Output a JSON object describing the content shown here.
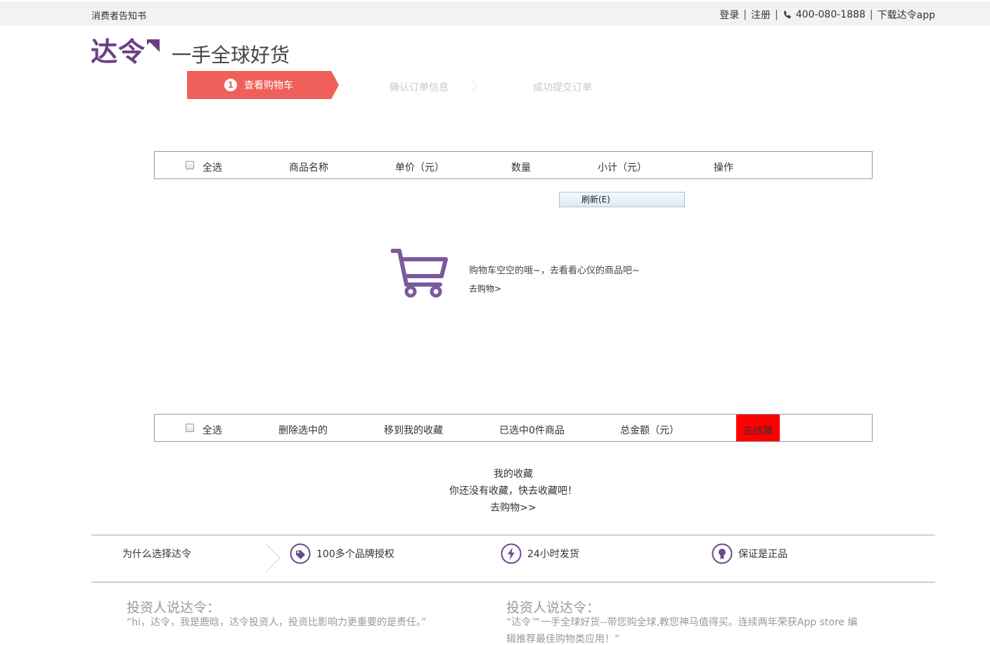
{
  "topbar": {
    "notice": "消费者告知书",
    "login": "登录",
    "register": "注册",
    "phone": "400-080-1888",
    "download_app": "下载达令app",
    "separator": "|"
  },
  "header": {
    "brand": "达令",
    "slogan": "一手全球好货"
  },
  "steps": {
    "step1_num": "1",
    "step1_label": "查看购物车",
    "step2_label": "确认订单信息",
    "step3_label": "成功提交订单"
  },
  "cart_header": {
    "select_all": "全选",
    "product_name": "商品名称",
    "unit_price": "单价（元）",
    "quantity": "数量",
    "subtotal": "小计（元）",
    "action": "操作"
  },
  "refresh_label": "刷新(E)",
  "empty_cart": {
    "message": "购物车空空的哦~，去看看心仪的商品吧~",
    "go_shopping": "去购物>"
  },
  "cart_footer": {
    "select_all": "全选",
    "delete_selected": "删除选中的",
    "move_to_fav": "移到我的收藏",
    "selected_count": "已选中0件商品",
    "total_amount": "总金额（元）",
    "checkout": "去结算"
  },
  "favorites": {
    "title": "我的收藏",
    "empty_message": "你还没有收藏，快去收藏吧！",
    "go_shopping": "去购物>>"
  },
  "why_choose": {
    "title": "为什么选择达令",
    "features": [
      {
        "icon": "tag-icon",
        "label": "100多个品牌授权"
      },
      {
        "icon": "lightning-icon",
        "label": "24小时发货"
      },
      {
        "icon": "badge-icon",
        "label": "保证是正品"
      }
    ]
  },
  "investor_quotes": [
    {
      "title": "投资人说达令：",
      "text": "“hi，达令，我是鹿晗，达令投资人，投资比影响力更重要的是责任。”"
    },
    {
      "title": "投资人说达令：",
      "text": "“达令™一手全球好货--带您购全球,教您神马值得买。连续两年荣获App store 编辑推荐最佳购物类应用！”"
    }
  ],
  "colors": {
    "brand_purple": "#6b3f86",
    "step_active": "#f0605a",
    "checkout_red": "#ff0000",
    "icon_purple": "#6b4a8f"
  }
}
